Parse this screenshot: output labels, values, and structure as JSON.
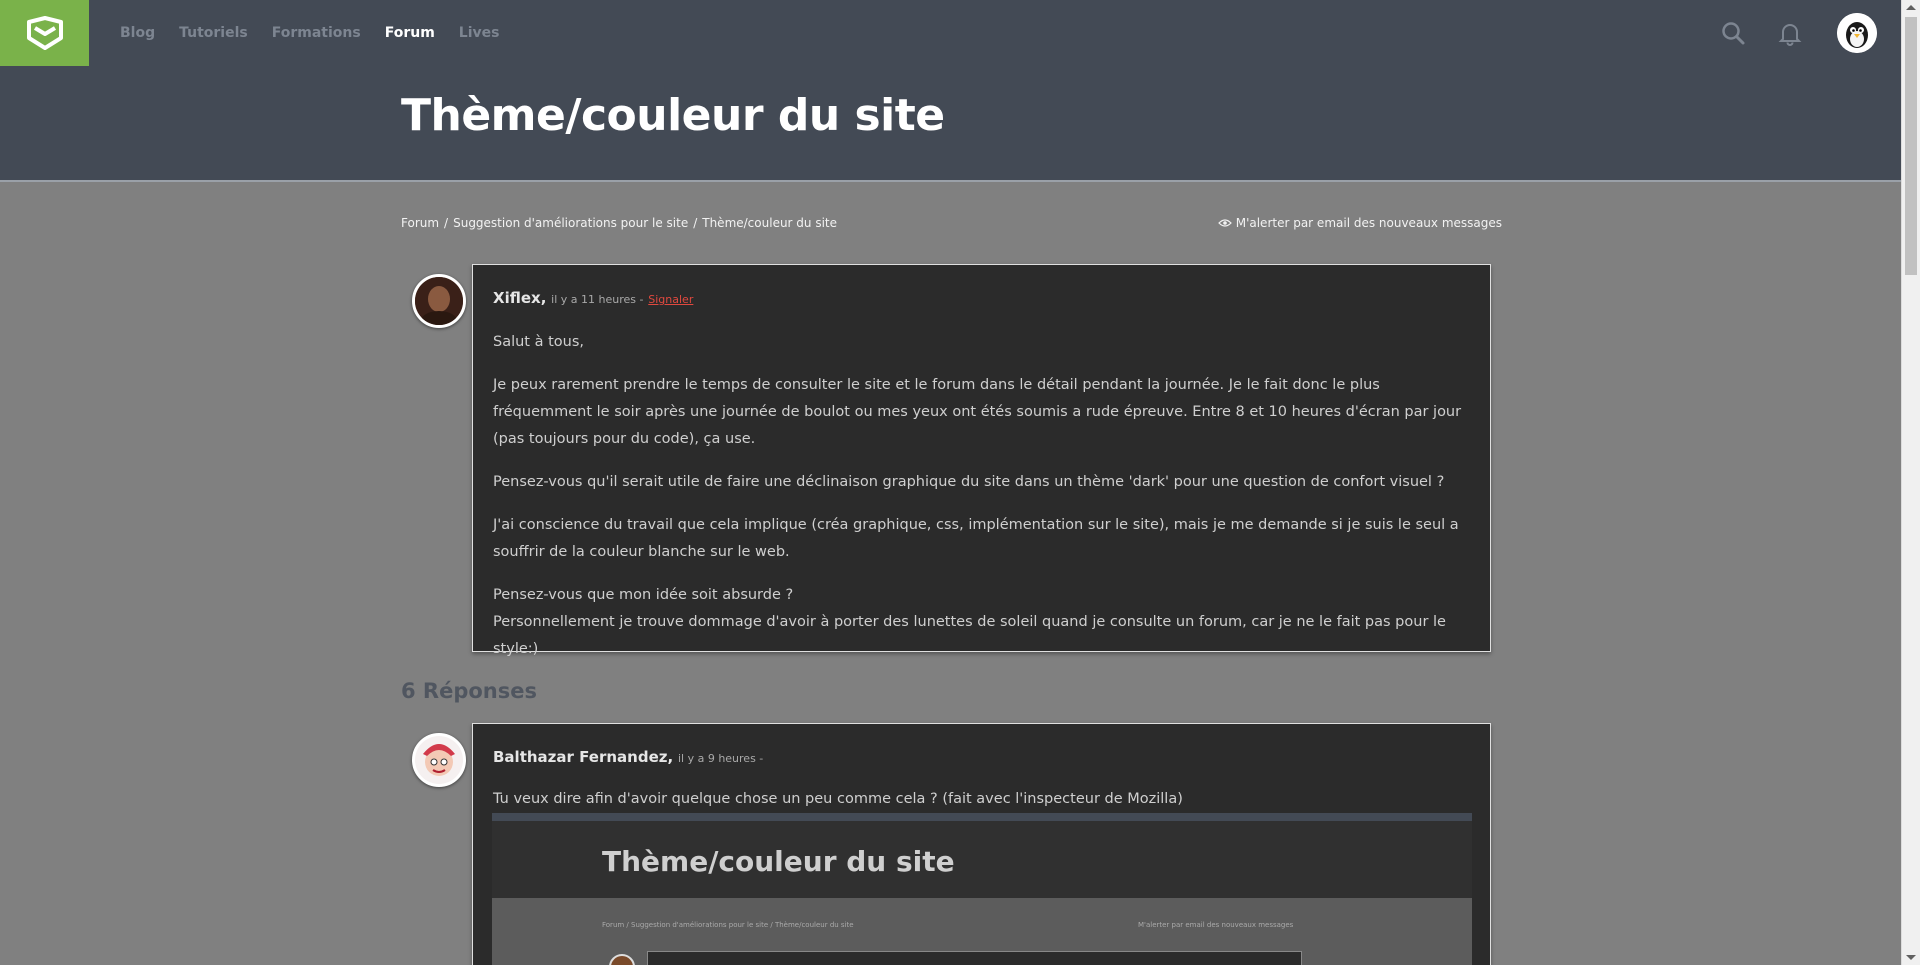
{
  "nav": {
    "items": [
      {
        "label": "Blog",
        "active": false
      },
      {
        "label": "Tutoriels",
        "active": false
      },
      {
        "label": "Formations",
        "active": false
      },
      {
        "label": "Forum",
        "active": true
      },
      {
        "label": "Lives",
        "active": false
      }
    ],
    "icons": [
      "search-icon",
      "bell-icon",
      "user-avatar"
    ]
  },
  "page": {
    "title": "Thème/couleur du site"
  },
  "breadcrumb": {
    "items": [
      "Forum",
      "/",
      "Suggestion d'améliorations pour le site",
      "/",
      "Thème/couleur du site"
    ]
  },
  "alert": {
    "label": "M'alerter par email des nouveaux messages"
  },
  "post": {
    "author": "Xiflex",
    "sep": ",",
    "time": "il y a 11 heures -",
    "report": "Signaler",
    "paragraphs": [
      "Salut à tous,",
      "Je peux rarement prendre le temps de consulter le site et le forum dans le détail pendant la journée. Je le fait donc le plus fréquemment le soir après une journée de boulot ou mes yeux ont étés soumis a rude épreuve. Entre 8 et 10 heures d'écran par jour (pas toujours pour du code), ça use.",
      "Pensez-vous qu'il serait utile de faire une déclinaison graphique du site dans un thème 'dark' pour une question de confort visuel ?",
      "J'ai conscience du travail que cela implique (créa graphique, css, implémentation sur le site), mais je me demande si je suis le seul a souffrir de la couleur blanche sur le web.",
      "Pensez-vous que mon idée soit absurde ?",
      "Personnellement je trouve dommage d'avoir à porter des lunettes de soleil quand je consulte un forum, car je ne le fait pas pour le style:)"
    ]
  },
  "replies": {
    "title": "6 Réponses"
  },
  "reply": {
    "author": "Balthazar Fernandez",
    "sep": ",",
    "time": "il y a 9 heures -",
    "text": "Tu veux dire afin d'avoir quelque chose un peu comme cela ? (fait avec l'inspecteur de Mozilla)"
  },
  "embed": {
    "title": "Thème/couleur du site",
    "breadcrumb": "Forum / Suggestion d'améliorations pour le site / Thème/couleur du site",
    "alert": "M'alerter par email des nouveaux messages"
  },
  "colors": {
    "brand": "#7ab24a",
    "header": "#434a55",
    "background": "#808080",
    "post_bg": "#2b2b2b",
    "report": "#e0493f"
  }
}
